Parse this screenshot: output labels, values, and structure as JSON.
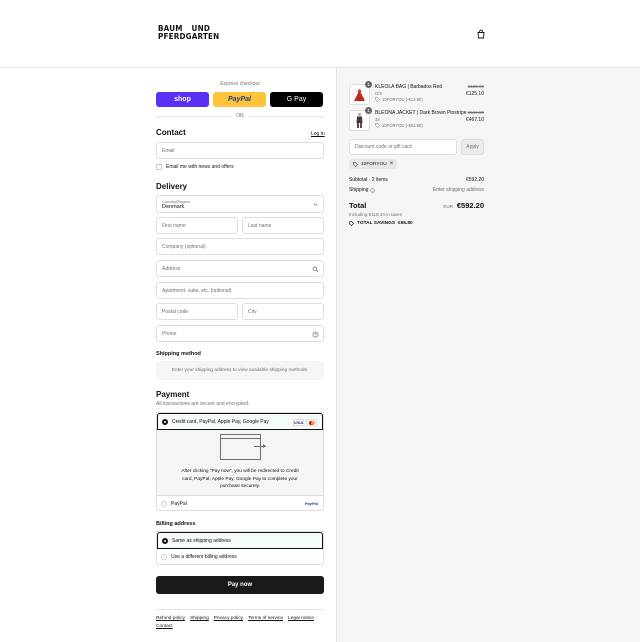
{
  "header": {
    "logo_line1_left": "BAUM",
    "logo_line1_right": "UND",
    "logo_line2": "PFERDGARTEN"
  },
  "express": {
    "label": "Express checkout",
    "shop_label": "shop",
    "paypal_label": "PayPal",
    "gpay_label": "G Pay",
    "or_label": "OR"
  },
  "contact": {
    "title": "Contact",
    "login_link": "Log in",
    "email_placeholder": "Email",
    "newsletter_label": "Email me with news and offers"
  },
  "delivery": {
    "title": "Delivery",
    "country_label": "Country/Region",
    "country_value": "Denmark",
    "first_name": "First name",
    "last_name": "Last name",
    "company": "Company (optional)",
    "address": "Address",
    "apartment": "Apartment, suite, etc. (optional)",
    "postal_code": "Postal code",
    "city": "City",
    "phone": "Phone"
  },
  "shipping": {
    "title": "Shipping method",
    "info": "Enter your shipping address to view available shipping methods."
  },
  "payment": {
    "title": "Payment",
    "secure_text": "All transactions are secure and encrypted.",
    "option_card": "Credit card, PayPal, Apple Pay, Google Pay",
    "visa_label": "VISA",
    "redirect_text": "After clicking “Pay now”, you will be redirected to Credit card, PayPal, Apple Pay, Google Pay to complete your purchase securely.",
    "option_paypal": "PayPal",
    "paypal_logo": "PayPal"
  },
  "billing": {
    "title": "Billing address",
    "same": "Same as shipping address",
    "different": "Use a different billing address"
  },
  "pay_now": "Pay now",
  "footer": {
    "refund": "Refund policy",
    "shipping": "Shipping",
    "privacy": "Privacy policy",
    "terms": "Terms of service",
    "legal": "Legal notice",
    "contact": "Contact"
  },
  "summary": {
    "items": [
      {
        "qty": "1",
        "name": "KLEOLA BAG | Barbados Red",
        "variant": "O/S",
        "discount": "10FORYOU (-€13.90)",
        "old_price": "€139.00",
        "price": "€125.10"
      },
      {
        "qty": "1",
        "name": "BLEONA JACKET | Dark Brown Pinstripe",
        "variant": "34",
        "discount": "10FORYOU (-€51.90)",
        "old_price": "€519.00",
        "price": "€467.10"
      }
    ],
    "discount_placeholder": "Discount code or gift card",
    "apply_label": "Apply",
    "applied_code": "10FORYOU",
    "subtotal_label": "Subtotal · 2 items",
    "subtotal_value": "€592.20",
    "shipping_label": "Shipping",
    "shipping_value": "Enter shipping address",
    "total_label": "Total",
    "currency": "EUR",
    "total_value": "€592.20",
    "tax_line": "Including €118.44 in taxes",
    "savings_label": "TOTAL SAVINGS",
    "savings_value": "€65.80"
  },
  "colors": {
    "shop_purple": "#5a31f4",
    "paypal_yellow": "#ffc439",
    "gpay_black": "#000000",
    "bag_red": "#c0281c",
    "jacket_brown": "#4a3a30"
  }
}
